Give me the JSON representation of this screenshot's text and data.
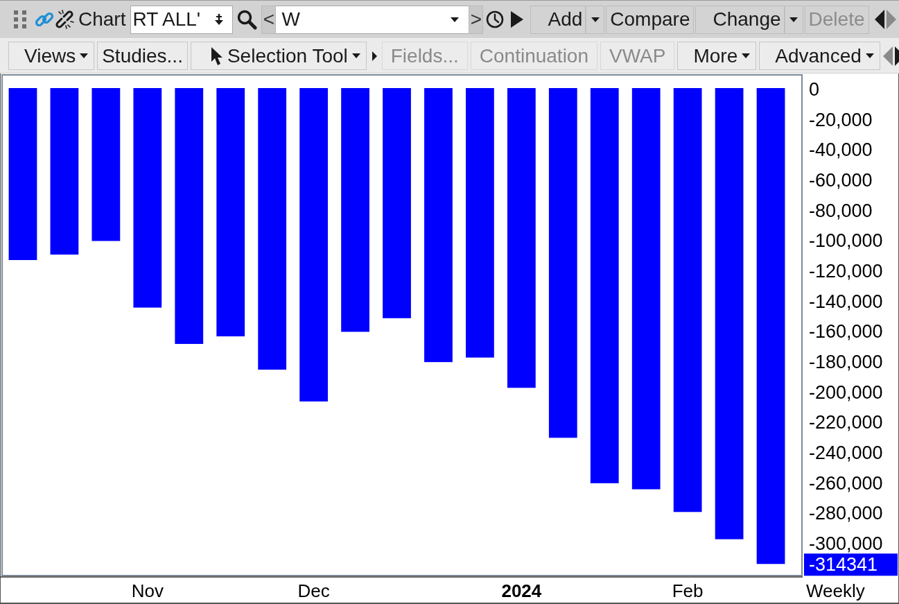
{
  "top_toolbar": {
    "title": "Chart",
    "symbol_field": {
      "value": "RT ALL'"
    },
    "prev_button": "<",
    "interval_field": {
      "value": "W"
    },
    "next_button": ">",
    "buttons": [
      {
        "label": "Add",
        "dropdown": true,
        "disabled": false
      },
      {
        "label": "Compare",
        "dropdown": false,
        "disabled": false
      },
      {
        "label": "Change",
        "dropdown": true,
        "disabled": false
      },
      {
        "label": "Delete",
        "dropdown": false,
        "disabled": true
      }
    ]
  },
  "second_toolbar": {
    "buttons": [
      {
        "label": "Views",
        "dropdown": true,
        "disabled": false
      },
      {
        "label": "Studies...",
        "dropdown": false,
        "disabled": false
      }
    ],
    "selection_tool": {
      "label": "Selection Tool",
      "dropdown": true,
      "disabled": false
    },
    "chart_buttons": [
      {
        "label": "Fields...",
        "dropdown": false,
        "disabled": true
      },
      {
        "label": "Continuation",
        "dropdown": false,
        "disabled": true
      },
      {
        "label": "VWAP",
        "dropdown": false,
        "disabled": true
      },
      {
        "label": "More",
        "dropdown": true,
        "disabled": false
      },
      {
        "label": "Advanced",
        "dropdown": true,
        "disabled": false
      }
    ]
  },
  "chart": {
    "chart_data": {
      "type": "bar",
      "xlabel": "Weekly",
      "categories": [
        null,
        null,
        null,
        "Nov",
        null,
        null,
        null,
        "Dec",
        null,
        null,
        null,
        null,
        "**2024**",
        null,
        null,
        null,
        "Feb",
        null,
        null
      ],
      "ylim": [
        -322000,
        8700
      ],
      "series": [
        {
          "color": "#0000ff",
          "values": [
            -113600,
            -110000,
            -101000,
            -145000,
            -169000,
            -164000,
            -186000,
            -207000,
            -161000,
            -152000,
            -181000,
            -178000,
            -198000,
            -231000,
            -261000,
            -265000,
            -280000,
            -298000,
            -314341
          ]
        }
      ],
      "yticks": [
        {
          "value": 0,
          "label": "0"
        },
        {
          "value": -20000,
          "label": "-20,000"
        },
        {
          "value": -40000,
          "label": "-40,000"
        },
        {
          "value": -60000,
          "label": "-60,000"
        },
        {
          "value": -80000,
          "label": "-80,000"
        },
        {
          "value": -100000,
          "label": "-100,000"
        },
        {
          "value": -120000,
          "label": "-120,000"
        },
        {
          "value": -140000,
          "label": "-140,000"
        },
        {
          "value": -160000,
          "label": "-160,000"
        },
        {
          "value": -180000,
          "label": "-180,000"
        },
        {
          "value": -200000,
          "label": "-200,000"
        },
        {
          "value": -220000,
          "label": "-220,000"
        },
        {
          "value": -240000,
          "label": "-240,000"
        },
        {
          "value": -260000,
          "label": "-260,000"
        },
        {
          "value": -280000,
          "label": "-280,000"
        },
        {
          "value": -300000,
          "label": "-300,000"
        }
      ]
    },
    "last_value_label": "-314341"
  }
}
